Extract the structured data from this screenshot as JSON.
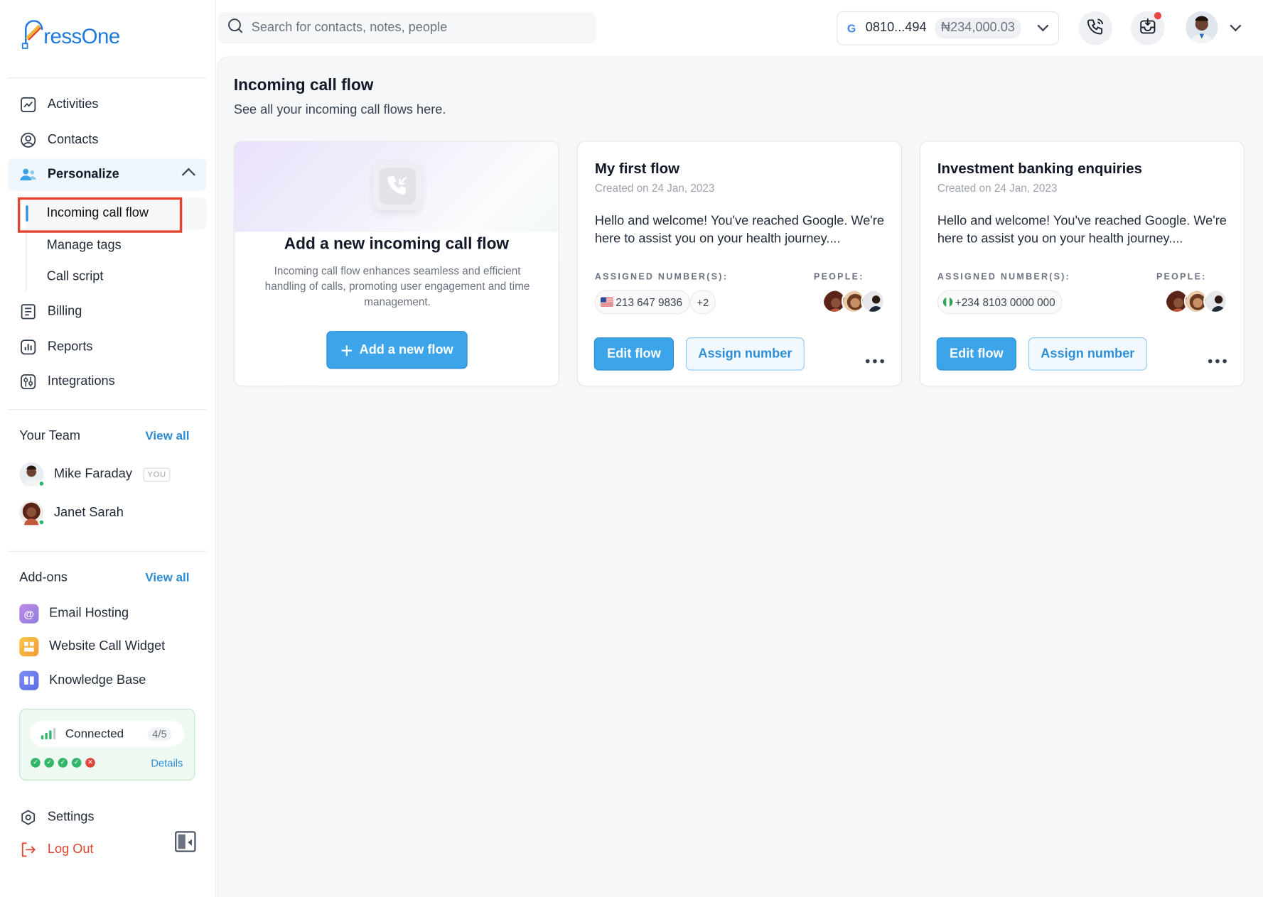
{
  "brand": {
    "name": "ressOne"
  },
  "search": {
    "placeholder": "Search for contacts, notes, people"
  },
  "account": {
    "provider_icon": "google-icon",
    "provider_letter": "G",
    "number": "0810...494",
    "balance": "₦234,000.03"
  },
  "sidebar": {
    "nav": [
      {
        "label": "Activities",
        "icon": "activity-chart-icon"
      },
      {
        "label": "Contacts",
        "icon": "user-circle-icon"
      },
      {
        "label": "Personalize",
        "icon": "users-icon",
        "expanded": true
      },
      {
        "label": "Billing",
        "icon": "receipt-icon"
      },
      {
        "label": "Reports",
        "icon": "bar-chart-icon"
      },
      {
        "label": "Integrations",
        "icon": "integrations-icon"
      }
    ],
    "personalize_sub": [
      "Incoming call flow",
      "Manage tags",
      "Call script"
    ],
    "team": {
      "title": "Your Team",
      "view_all": "View all",
      "members": [
        {
          "name": "Mike Faraday",
          "badge": "YOU",
          "status": "online"
        },
        {
          "name": "Janet Sarah",
          "status": "online"
        }
      ]
    },
    "addons": {
      "title": "Add-ons",
      "view_all": "View all",
      "items": [
        {
          "label": "Email Hosting",
          "icon": "at-sign-icon",
          "color": "#a77bd6"
        },
        {
          "label": "Website Call Widget",
          "icon": "widget-icon",
          "color": "#f2b43a"
        },
        {
          "label": "Knowledge Base",
          "icon": "book-icon",
          "color": "#6b7bf0"
        }
      ]
    },
    "connection": {
      "status": "Connected",
      "count": "4/5",
      "details": "Details",
      "checks": [
        "ok",
        "ok",
        "ok",
        "ok",
        "error"
      ]
    },
    "settings": "Settings",
    "logout": "Log Out"
  },
  "page": {
    "title": "Incoming call flow",
    "subtitle": "See all your incoming call flows here."
  },
  "new_flow_card": {
    "title": "Add a new incoming call flow",
    "description": "Incoming call flow enhances seamless and efficient handling of calls, promoting user engagement and time management.",
    "button": "Add a new flow"
  },
  "flows": [
    {
      "title": "My first flow",
      "created": "Created on 24 Jan, 2023",
      "message": "Hello and welcome! You've reached Google. We're here to assist you on your health journey....",
      "assigned_label": "ASSIGNED NUMBER(S):",
      "people_label": "PEOPLE:",
      "number": "213 647 9836",
      "flag": "us-flag-icon",
      "extra": "+2",
      "edit": "Edit flow",
      "assign": "Assign number"
    },
    {
      "title": "Investment banking enquiries",
      "created": "Created on 24 Jan, 2023",
      "message": "Hello and welcome! You've reached Google. We're here to assist you on your health journey....",
      "assigned_label": "ASSIGNED NUMBER(S):",
      "people_label": "PEOPLE:",
      "number": "+234 8103 0000 000",
      "flag": "ng-flag-icon",
      "extra": "",
      "edit": "Edit flow",
      "assign": "Assign number"
    }
  ],
  "colors": {
    "accent": "#3ca4e8",
    "link": "#2c8dd6",
    "danger": "#e0452f",
    "online": "#2fb46d"
  }
}
